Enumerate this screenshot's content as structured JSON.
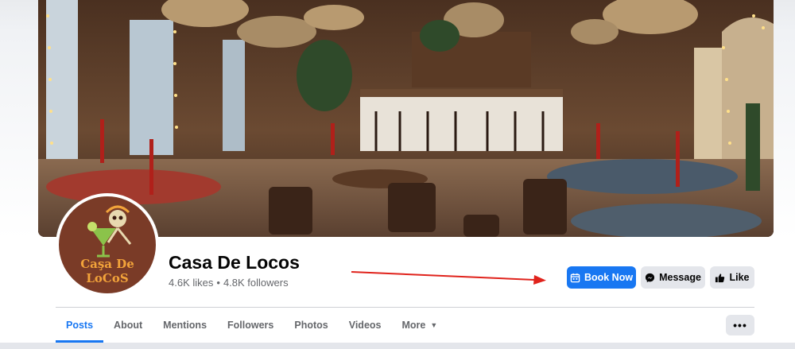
{
  "page": {
    "name": "Casa De Locos",
    "likes": "4.6K likes",
    "separator": "•",
    "followers": "4.8K followers",
    "logo_text": "Caşa De LoCoS"
  },
  "actions": {
    "book_now": "Book Now",
    "message": "Message",
    "like": "Like"
  },
  "tabs": [
    {
      "label": "Posts",
      "active": true
    },
    {
      "label": "About"
    },
    {
      "label": "Mentions"
    },
    {
      "label": "Followers"
    },
    {
      "label": "Photos"
    },
    {
      "label": "Videos"
    },
    {
      "label": "More"
    }
  ],
  "more_options": "•••",
  "colors": {
    "accent": "#1877f2",
    "arrow": "#e0231c",
    "secondary_button": "#e4e6eb",
    "logo_background": "#7a3b27",
    "logo_text": "#f2a33a"
  },
  "icons": {
    "book_now": "calendar-icon",
    "message": "messenger-icon",
    "like": "thumbs-up-icon",
    "more": "caret-down-icon"
  }
}
